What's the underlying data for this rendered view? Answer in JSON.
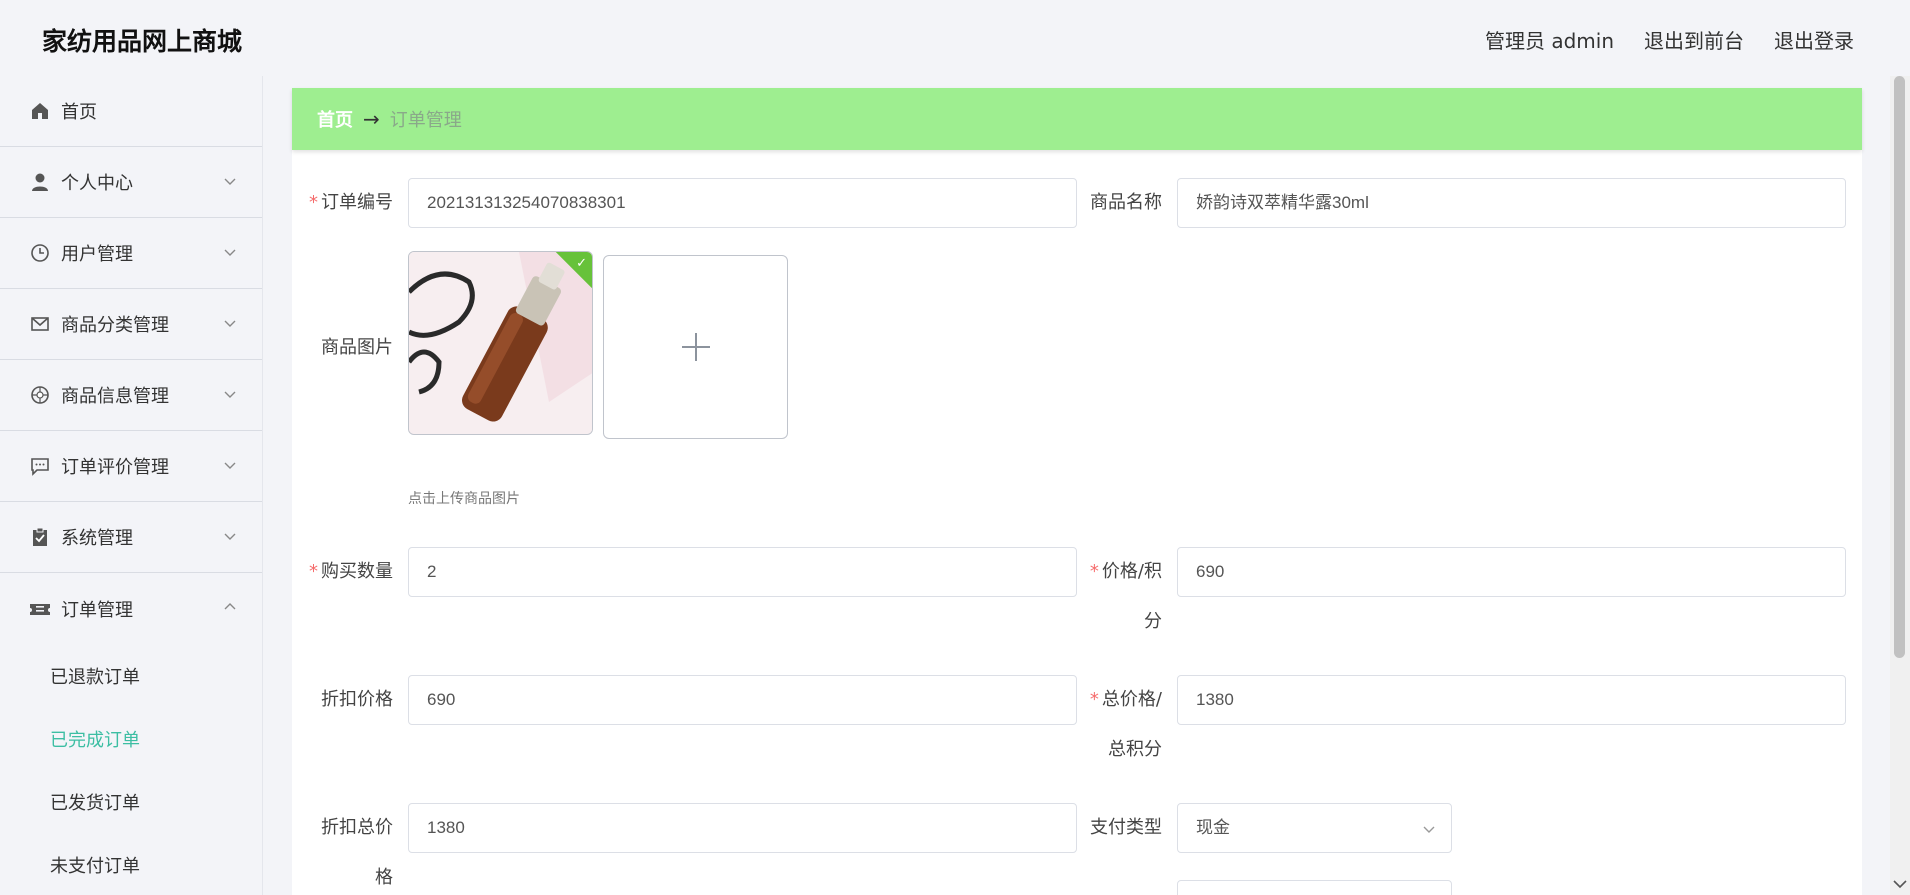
{
  "header": {
    "brand": "家纺用品网上商城",
    "user": "管理员 admin",
    "to_front": "退出到前台",
    "logout": "退出登录"
  },
  "sidebar": {
    "items": [
      {
        "label": "首页",
        "icon": "home-icon"
      },
      {
        "label": "个人中心",
        "icon": "user-icon"
      },
      {
        "label": "用户管理",
        "icon": "clock-icon"
      },
      {
        "label": "商品分类管理",
        "icon": "mail-icon"
      },
      {
        "label": "商品信息管理",
        "icon": "compass-icon"
      },
      {
        "label": "订单评价管理",
        "icon": "chat-icon"
      },
      {
        "label": "系统管理",
        "icon": "clipboard-icon"
      },
      {
        "label": "订单管理",
        "icon": "ticket-icon"
      }
    ],
    "submenu": [
      "已退款订单",
      "已完成订单",
      "已发货订单",
      "未支付订单"
    ],
    "active_sub": "已完成订单"
  },
  "breadcrumb": {
    "home": "首页",
    "arrow": "→",
    "current": "订单管理"
  },
  "form": {
    "order_no_label": "订单编号",
    "order_no": "20213131325407083830​1",
    "product_name_label": "商品名称",
    "product_name": "娇韵诗双萃精华露30ml",
    "product_image_label": "商品图片",
    "upload_hint": "点击上传商品图片",
    "quantity_label": "购买数量",
    "quantity": "2",
    "price_label_1": "价格/积",
    "price_label_2": "分",
    "price": "690",
    "discount_price_label": "折扣价格",
    "discount_price": "690",
    "total_label_1": "总价格/",
    "total_label_2": "总积分",
    "total": "1380",
    "discount_total_label_1": "折扣总价",
    "discount_total_label_2": "格",
    "discount_total": "1380",
    "pay_type_label": "支付类型",
    "pay_type": "现金"
  }
}
